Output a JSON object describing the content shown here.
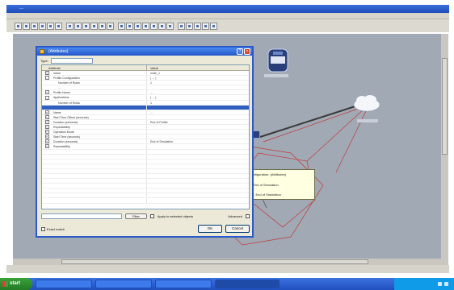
{
  "app": {
    "title": "—",
    "status": ""
  },
  "toolbar": {
    "icons": [
      "new-icon",
      "open-icon",
      "save-icon",
      "print-icon",
      "cut-icon",
      "copy-icon",
      "paste-icon",
      "undo-icon",
      "redo-icon",
      "zoom-in-icon",
      "zoom-out-icon",
      "select-icon",
      "link-icon",
      "node-icon",
      "router-icon",
      "switch-icon",
      "host-icon",
      "server-icon",
      "cloud-icon",
      "run-icon",
      "stop-icon",
      "chart-icon",
      "table-icon",
      "help-icon"
    ]
  },
  "dialog": {
    "title": "(Attributes)",
    "type_label": "Type:",
    "type_value": "",
    "grid": {
      "header_attribute": "Attribute",
      "header_value": "Value",
      "rows": [
        {
          "attr": "name",
          "value": "node_1",
          "exp": "+"
        },
        {
          "attr": "Profile Configuration",
          "value": "( ... )",
          "exp": "-"
        },
        {
          "attr": "Number of Rows",
          "value": "1",
          "exp": ""
        },
        {
          "attr": "...",
          "value": "",
          "exp": ""
        },
        {
          "attr": "Profile Name",
          "value": "...",
          "exp": "+"
        },
        {
          "attr": "Applications",
          "value": "( ... )",
          "exp": "-"
        },
        {
          "attr": "Number of Rows",
          "value": "1",
          "exp": ""
        },
        {
          "attr": "",
          "value": "",
          "exp": "",
          "selected": true
        },
        {
          "attr": "Name",
          "value": "...",
          "exp": "+"
        },
        {
          "attr": "Start Time Offset (seconds)",
          "value": "",
          "exp": "+"
        },
        {
          "attr": "Duration (seconds)",
          "value": "End of Profile",
          "exp": "+"
        },
        {
          "attr": "Repeatability",
          "value": "",
          "exp": "+"
        },
        {
          "attr": "Operation Mode",
          "value": "",
          "exp": "+"
        },
        {
          "attr": "Start Time (seconds)",
          "value": "",
          "exp": "+"
        },
        {
          "attr": "Duration (seconds)",
          "value": "End of Simulation",
          "exp": "+"
        },
        {
          "attr": "Repeatability",
          "value": "",
          "exp": "+"
        },
        {
          "attr": "",
          "value": "",
          "exp": ""
        },
        {
          "attr": "",
          "value": "",
          "exp": ""
        },
        {
          "attr": "",
          "value": "",
          "exp": ""
        },
        {
          "attr": "",
          "value": "",
          "exp": ""
        },
        {
          "attr": "",
          "value": "",
          "exp": ""
        },
        {
          "attr": "",
          "value": "",
          "exp": ""
        },
        {
          "attr": "",
          "value": "",
          "exp": ""
        },
        {
          "attr": "",
          "value": "",
          "exp": ""
        },
        {
          "attr": "",
          "value": "",
          "exp": ""
        },
        {
          "attr": "",
          "value": "",
          "exp": ""
        },
        {
          "attr": "",
          "value": "",
          "exp": ""
        }
      ]
    },
    "filter_button": "Filter",
    "apply_label": "Apply to selected objects",
    "advanced_label": "Advanced",
    "exact_match_label": "Exact match",
    "ok_label": "OK",
    "cancel_label": "Cancel"
  },
  "tooltip": {
    "lines": [
      "Profile Configuration: (Attributes)",
      "Duration: End of Simulation",
      "Start Time: End of Simulation"
    ]
  },
  "taskbar": {
    "start_label": "start",
    "tasks": [
      "",
      "",
      "",
      ""
    ],
    "clock": ""
  },
  "colors": {
    "canvas": "#a1a9b4",
    "link_dark": "#3a3a3a",
    "link_red": "#c23a3a",
    "selection": "#2f5fbf"
  }
}
